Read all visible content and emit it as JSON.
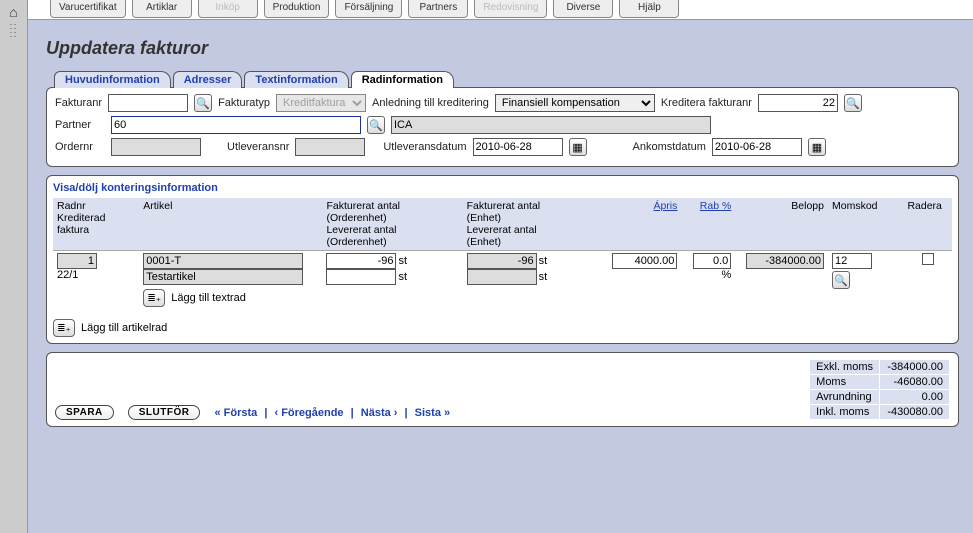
{
  "topTabs": [
    {
      "label": "Varucertifikat",
      "disabled": false
    },
    {
      "label": "Artiklar",
      "disabled": false
    },
    {
      "label": "Inköp",
      "disabled": true
    },
    {
      "label": "Produktion",
      "disabled": false
    },
    {
      "label": "Försäljning",
      "disabled": false
    },
    {
      "label": "Partners",
      "disabled": false
    },
    {
      "label": "Redovisning",
      "disabled": true
    },
    {
      "label": "Diverse",
      "disabled": false
    },
    {
      "label": "Hjälp",
      "disabled": false
    }
  ],
  "pageTitle": "Uppdatera fakturor",
  "subTabs": [
    "Huvudinformation",
    "Adresser",
    "Textinformation",
    "Radinformation"
  ],
  "activeSubTab": 3,
  "header": {
    "fakturanr_label": "Fakturanr",
    "fakturanr": "",
    "fakturatyp_label": "Fakturatyp",
    "fakturatyp": "Kreditfaktura",
    "anledning_label": "Anledning till kreditering",
    "anledning": "Finansiell kompensation",
    "kreditera_label": "Kreditera fakturanr",
    "kreditera": "22",
    "partner_label": "Partner",
    "partner_code": "60",
    "partner_name": "ICA",
    "ordernr_label": "Ordernr",
    "ordernr": "",
    "utleveransnr_label": "Utleveransnr",
    "utleveransnr": "",
    "utleveransdatum_label": "Utleveransdatum",
    "utleveransdatum": "2010-06-28",
    "ankomstdatum_label": "Ankomstdatum",
    "ankomstdatum": "2010-06-28"
  },
  "gridSectionTitle": "Visa/dölj konteringsinformation",
  "gridHeaders": {
    "radnr": "Radnr\nKrediterad\nfaktura",
    "artikel": "Artikel",
    "fakt_order": "Fakturerat antal\n(Orderenhet)\nLevererat antal\n(Orderenhet)",
    "fakt_enhet": "Fakturerat antal\n(Enhet)\nLevererat antal\n(Enhet)",
    "apris": "Ápris",
    "rab": "Rab %",
    "belopp": "Belopp",
    "momskod": "Momskod",
    "radera": "Radera"
  },
  "row": {
    "radnr": "1",
    "krediterad": "22/1",
    "artikel_code": "0001-T",
    "artikel_name": "Testartikel",
    "fakt_order_qty": "-96",
    "fakt_order_unit": "st",
    "lev_order_qty": "",
    "lev_order_unit": "st",
    "fakt_enhet_qty": "-96",
    "fakt_enhet_unit": "st",
    "lev_enhet_qty": "",
    "lev_enhet_unit": "st",
    "apris": "4000.00",
    "rab": "0.0",
    "rab_unit": "%",
    "belopp": "-384000.00",
    "momskod": "12",
    "add_textrad": "Lägg till textrad"
  },
  "add_artikelrad": "Lägg till artikelrad",
  "footer": {
    "spara": "SPARA",
    "slutfor": "SLUTFÖR",
    "pager_first": "« Första",
    "pager_prev": "‹ Föregående",
    "pager_next": "Nästa ›",
    "pager_last": "Sista »"
  },
  "totals": {
    "exkl_label": "Exkl. moms",
    "exkl": "-384000.00",
    "moms_label": "Moms",
    "moms": "-46080.00",
    "avrund_label": "Avrundning",
    "avrund": "0.00",
    "inkl_label": "Inkl. moms",
    "inkl": "-430080.00"
  }
}
